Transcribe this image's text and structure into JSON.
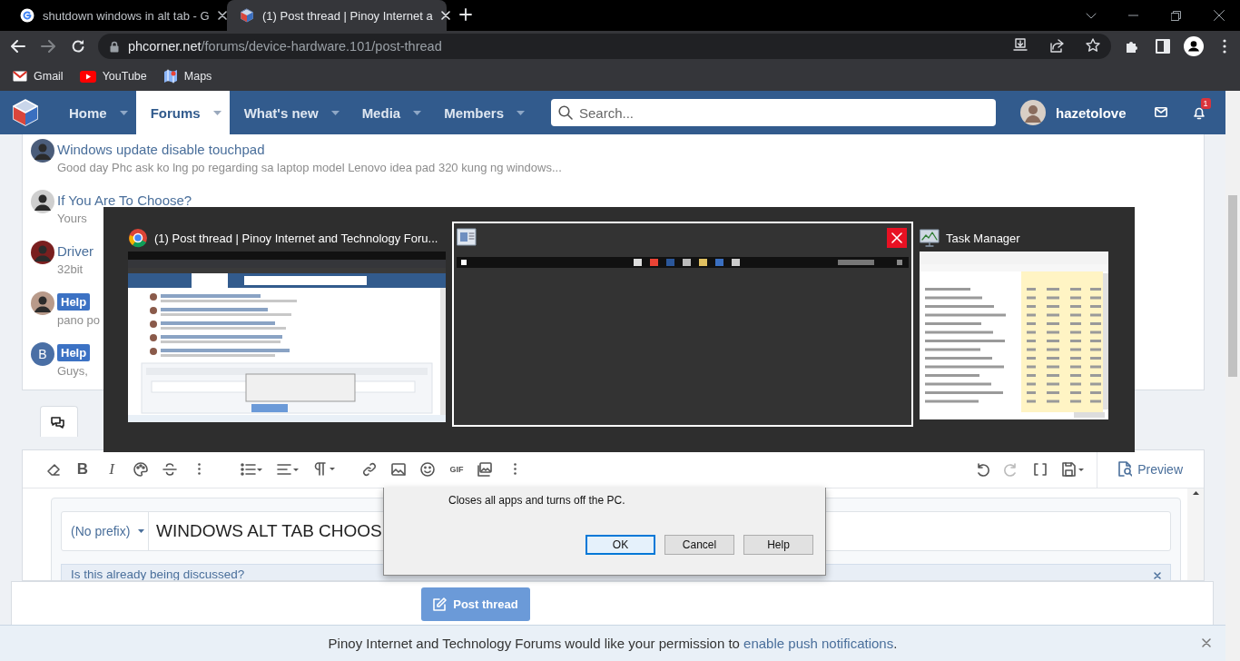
{
  "browser": {
    "tabs": [
      {
        "title": "shutdown windows in alt tab - G",
        "kind": "search",
        "selected": false
      },
      {
        "title": "(1) Post thread | Pinoy Internet a",
        "kind": "forum",
        "selected": true
      }
    ],
    "address": {
      "host": "phcorner.net",
      "path": "/forums/device-hardware.101/post-thread"
    },
    "bookmarks": [
      {
        "label": "Gmail",
        "kind": "mail"
      },
      {
        "label": "YouTube",
        "kind": "video"
      },
      {
        "label": "Maps",
        "kind": "map"
      }
    ]
  },
  "nav": {
    "items": [
      {
        "label": "Home",
        "selected": false
      },
      {
        "label": "Forums",
        "selected": true
      },
      {
        "label": "What's new",
        "selected": false
      },
      {
        "label": "Media",
        "selected": false
      },
      {
        "label": "Members",
        "selected": false
      }
    ],
    "search": {
      "placeholder": "Search..."
    },
    "user": "hazetolove",
    "alert_count": "1"
  },
  "threads": [
    {
      "title": "Windows update disable touchpad",
      "excerpt": "Good day Phc ask ko lng po regarding sa laptop model Lenovo idea pad 320 kung ng windows..."
    },
    {
      "title": "If You Are To Choose?",
      "excerpt": "Yours"
    },
    {
      "title": "Driver",
      "excerpt": "32bit"
    },
    {
      "prefix": "Help",
      "excerpt": "pano po"
    },
    {
      "prefix": "Help",
      "excerpt": "Guys,",
      "avatar_letter": "B"
    }
  ],
  "editor": {
    "tabs": [
      {
        "selected": true
      }
    ],
    "glyphs": {
      "bold": "B",
      "italic": "I",
      "gif": "GIF"
    },
    "preview": "Preview",
    "prefix": "(No prefix)",
    "title_value": "WINDOWS ALT TAB CHOOS",
    "similar_notice": "Is this already being discussed?"
  },
  "post_button": "Post thread",
  "notice": {
    "text": "Pinoy Internet and Technology Forums would like your permission to ",
    "link": "enable push notifications",
    "end": "."
  },
  "switcher": {
    "windows": [
      {
        "kind": "browser",
        "title": "(1) Post thread | Pinoy Internet and Technology Foru...",
        "selected": false
      },
      {
        "kind": "desktop",
        "selected": true
      },
      {
        "kind": "taskmanager",
        "title": "Task Manager",
        "selected": false
      }
    ]
  },
  "dialog": {
    "message": "Closes all apps and turns off the PC.",
    "buttons": [
      {
        "label": "OK",
        "selected": true
      },
      {
        "label": "Cancel",
        "selected": false
      },
      {
        "label": "Help",
        "selected": false
      }
    ]
  }
}
